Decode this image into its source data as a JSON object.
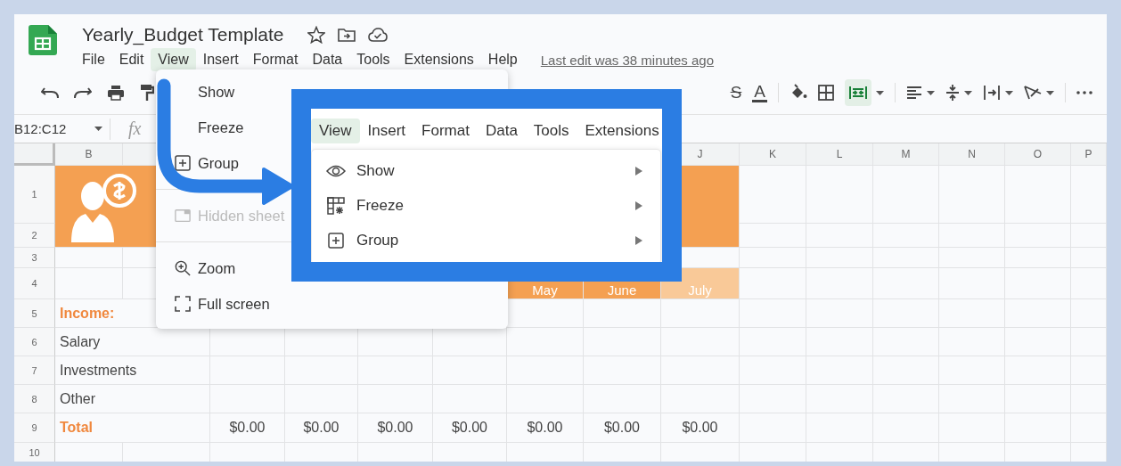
{
  "app": {
    "title": "Yearly_Budget Template",
    "menu": [
      {
        "label": "File",
        "selected": false
      },
      {
        "label": "Edit",
        "selected": false
      },
      {
        "label": "View",
        "selected": true
      },
      {
        "label": "Insert",
        "selected": false
      },
      {
        "label": "Format",
        "selected": false
      },
      {
        "label": "Data",
        "selected": false
      },
      {
        "label": "Tools",
        "selected": false
      },
      {
        "label": "Extensions",
        "selected": false
      },
      {
        "label": "Help",
        "selected": false
      }
    ],
    "last_edit": "Last edit was 38 minutes ago"
  },
  "toolbar": {
    "strikethrough": "S",
    "text_color": "A",
    "merge_cells_active": true
  },
  "formula_bar": {
    "name_box": "B12:C12",
    "fx": "fx"
  },
  "sheet": {
    "column_headers_left": [
      "B"
    ],
    "column_headers_right": [
      "J",
      "K",
      "L",
      "M",
      "N",
      "O",
      "P"
    ],
    "rows": [
      {
        "number": "1",
        "kind": "banner"
      },
      {
        "number": "2",
        "kind": "banner"
      },
      {
        "number": "3",
        "kind": "blank"
      },
      {
        "number": "4",
        "kind": "months",
        "months": [
          {
            "label": "May",
            "color": "#f4a052"
          },
          {
            "label": "June",
            "color": "#f4a052"
          },
          {
            "label": "July",
            "color": "#f9c998"
          }
        ]
      },
      {
        "number": "5",
        "kind": "section",
        "label": "Income:"
      },
      {
        "number": "6",
        "kind": "item",
        "label": "Salary"
      },
      {
        "number": "7",
        "kind": "item",
        "label": "Investments"
      },
      {
        "number": "8",
        "kind": "item",
        "label": "Other"
      },
      {
        "number": "9",
        "kind": "total",
        "label": "Total",
        "values": [
          "$0.00",
          "$0.00",
          "$0.00",
          "$0.00",
          "$0.00",
          "$0.00",
          "$0.00"
        ]
      },
      {
        "number": "10",
        "kind": "blank"
      }
    ]
  },
  "view_menu": {
    "groups": [
      [
        {
          "label": "Show",
          "disabled": false
        },
        {
          "label": "Freeze",
          "disabled": false
        },
        {
          "label": "Group",
          "disabled": false
        }
      ],
      [
        {
          "label": "Hidden sheet",
          "disabled": true
        }
      ],
      [
        {
          "label": "Zoom",
          "disabled": false
        },
        {
          "label": "Full screen",
          "disabled": false
        }
      ]
    ]
  },
  "callout": {
    "menu": [
      {
        "label": "View",
        "selected": true
      },
      {
        "label": "Insert",
        "selected": false
      },
      {
        "label": "Format",
        "selected": false
      },
      {
        "label": "Data",
        "selected": false
      },
      {
        "label": "Tools",
        "selected": false
      },
      {
        "label": "Extensions",
        "selected": false
      }
    ],
    "submenu": [
      {
        "label": "Show",
        "has_arrow": true
      },
      {
        "label": "Freeze",
        "has_arrow": true
      },
      {
        "label": "Group",
        "has_arrow": true
      }
    ]
  }
}
